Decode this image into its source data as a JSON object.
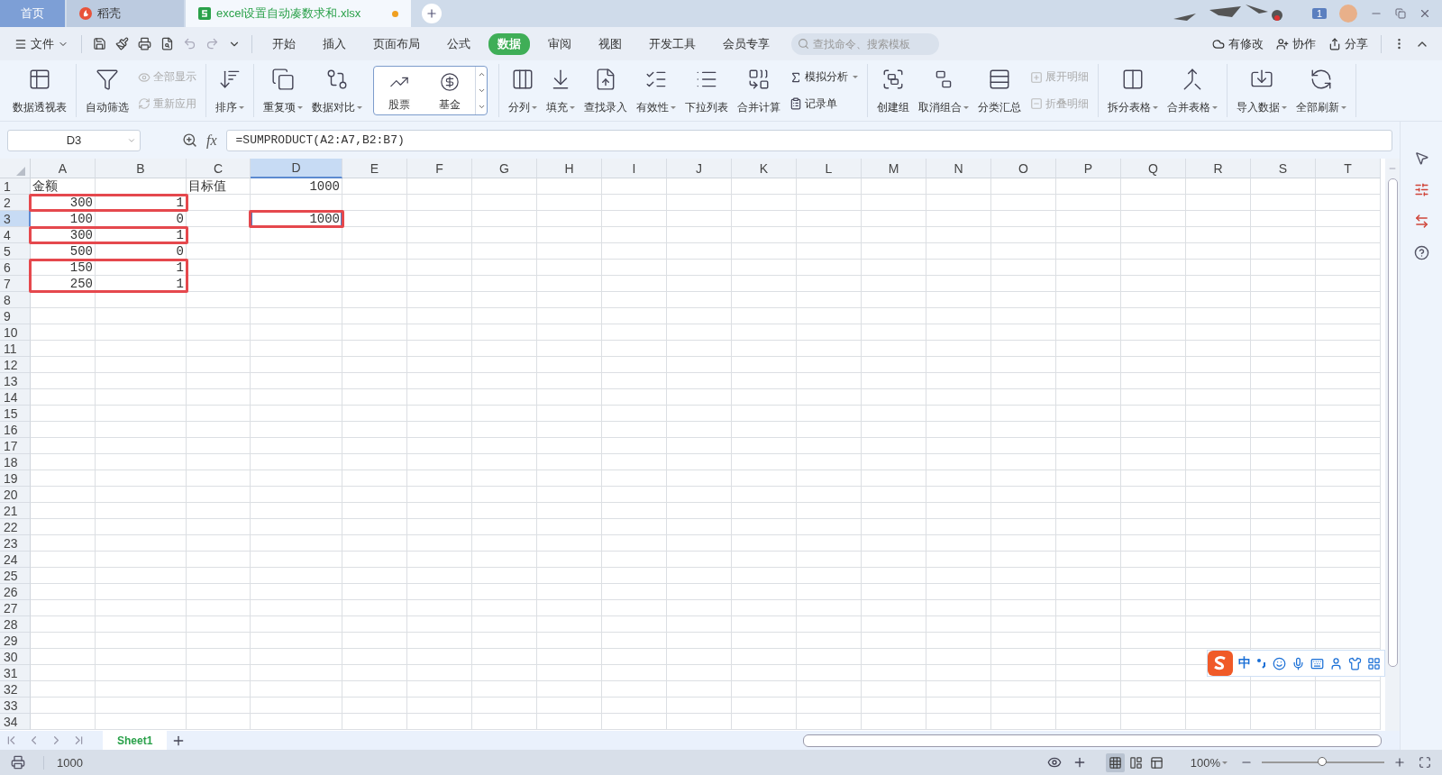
{
  "title_bar": {
    "tabs": [
      {
        "label": "首页",
        "kind": "home",
        "selected": false
      },
      {
        "label": "稻壳",
        "kind": "app",
        "selected": false
      },
      {
        "label": "excel设置自动凑数求和.xlsx",
        "kind": "document",
        "selected": true,
        "modified": true
      }
    ],
    "badge": "1"
  },
  "menu_bar": {
    "file": "文件",
    "tabs": [
      {
        "label": "开始",
        "selected": false
      },
      {
        "label": "插入",
        "selected": false
      },
      {
        "label": "页面布局",
        "selected": false
      },
      {
        "label": "公式",
        "selected": false
      },
      {
        "label": "数据",
        "selected": true
      },
      {
        "label": "审阅",
        "selected": false
      },
      {
        "label": "视图",
        "selected": false
      },
      {
        "label": "开发工具",
        "selected": false
      },
      {
        "label": "会员专享",
        "selected": false
      }
    ],
    "search": {
      "placeholder": "查找命令、搜索模板"
    },
    "actions": [
      "有修改",
      "协作",
      "分享"
    ]
  },
  "ribbon": {
    "groups": [
      {
        "items": [
          {
            "kind": "large",
            "label": "数据透视表",
            "dropdown": false,
            "disabled": false
          }
        ]
      },
      {
        "items": [
          {
            "kind": "large",
            "label": "自动筛选",
            "dropdown": false,
            "disabled": false
          },
          {
            "kind": "small",
            "label": "全部显示",
            "dropdown": false,
            "disabled": true
          },
          {
            "kind": "small",
            "label": "重新应用",
            "dropdown": false,
            "disabled": true
          }
        ]
      },
      {
        "items": [
          {
            "kind": "large",
            "label": "排序",
            "dropdown": true,
            "disabled": false
          }
        ]
      },
      {
        "items": [
          {
            "kind": "large",
            "label": "重复项",
            "dropdown": true,
            "disabled": false
          },
          {
            "kind": "large",
            "label": "数据对比",
            "dropdown": true,
            "disabled": false
          },
          {
            "kind": "gallery",
            "entries": [
              "股票",
              "基金"
            ]
          }
        ]
      },
      {
        "items": [
          {
            "kind": "large",
            "label": "分列",
            "dropdown": true,
            "disabled": false
          },
          {
            "kind": "large",
            "label": "填充",
            "dropdown": true,
            "disabled": false
          },
          {
            "kind": "large",
            "label": "查找录入",
            "dropdown": false,
            "disabled": false
          },
          {
            "kind": "large",
            "label": "有效性",
            "dropdown": true,
            "disabled": false
          },
          {
            "kind": "large",
            "label": "下拉列表",
            "dropdown": false,
            "disabled": false
          },
          {
            "kind": "large",
            "label": "合并计算",
            "dropdown": false,
            "disabled": false
          },
          {
            "kind": "small",
            "label": "模拟分析",
            "dropdown": true,
            "disabled": false
          },
          {
            "kind": "small",
            "label": "记录单",
            "dropdown": false,
            "disabled": false
          }
        ]
      },
      {
        "items": [
          {
            "kind": "large",
            "label": "创建组",
            "dropdown": false,
            "disabled": false
          },
          {
            "kind": "large",
            "label": "取消组合",
            "dropdown": true,
            "disabled": false
          },
          {
            "kind": "large",
            "label": "分类汇总",
            "dropdown": false,
            "disabled": false
          },
          {
            "kind": "small",
            "label": "展开明细",
            "dropdown": false,
            "disabled": true
          },
          {
            "kind": "small",
            "label": "折叠明细",
            "dropdown": false,
            "disabled": true
          }
        ]
      },
      {
        "items": [
          {
            "kind": "large",
            "label": "拆分表格",
            "dropdown": true,
            "disabled": false
          },
          {
            "kind": "large",
            "label": "合并表格",
            "dropdown": true,
            "disabled": false
          }
        ]
      },
      {
        "items": [
          {
            "kind": "large",
            "label": "导入数据",
            "dropdown": true,
            "disabled": false
          },
          {
            "kind": "large",
            "label": "全部刷新",
            "dropdown": true,
            "disabled": false
          }
        ]
      }
    ]
  },
  "formula_bar": {
    "name_box": "D3",
    "fx_label": "fx",
    "formula": "=SUMPRODUCT(A2:A7,B2:B7)"
  },
  "sheet": {
    "columns": [
      "A",
      "B",
      "C",
      "D",
      "E",
      "F",
      "G",
      "H",
      "I",
      "J",
      "K",
      "L",
      "M",
      "N",
      "O",
      "P",
      "Q",
      "R",
      "S",
      "T"
    ],
    "rows": [
      {
        "label": "1",
        "cells": {
          "A": {
            "value": "金额",
            "kind": "text",
            "selected": false,
            "framed": false
          },
          "C": {
            "value": "目标值",
            "kind": "text",
            "selected": false,
            "framed": false
          },
          "D": {
            "value": "1000",
            "kind": "number",
            "selected": false,
            "framed": false
          }
        }
      },
      {
        "label": "2",
        "cells": {
          "A": {
            "value": "300",
            "kind": "number",
            "selected": false,
            "framed": true
          },
          "B": {
            "value": "1",
            "kind": "number",
            "selected": false,
            "framed": true
          }
        }
      },
      {
        "label": "3",
        "cells": {
          "A": {
            "value": "100",
            "kind": "number",
            "selected": false,
            "framed": false
          },
          "B": {
            "value": "0",
            "kind": "number",
            "selected": false,
            "framed": false
          },
          "D": {
            "value": "1000",
            "kind": "number",
            "selected": true,
            "framed": true
          }
        }
      },
      {
        "label": "4",
        "cells": {
          "A": {
            "value": "300",
            "kind": "number",
            "selected": false,
            "framed": true
          },
          "B": {
            "value": "1",
            "kind": "number",
            "selected": false,
            "framed": true
          }
        }
      },
      {
        "label": "5",
        "cells": {
          "A": {
            "value": "500",
            "kind": "number",
            "selected": false,
            "framed": false
          },
          "B": {
            "value": "0",
            "kind": "number",
            "selected": false,
            "framed": false
          }
        }
      },
      {
        "label": "6",
        "cells": {
          "A": {
            "value": "150",
            "kind": "number",
            "selected": false,
            "framed": true
          },
          "B": {
            "value": "1",
            "kind": "number",
            "selected": false,
            "framed": true
          }
        }
      },
      {
        "label": "7",
        "cells": {
          "A": {
            "value": "250",
            "kind": "number",
            "selected": false,
            "framed": true
          },
          "B": {
            "value": "1",
            "kind": "number",
            "selected": false,
            "framed": true
          }
        }
      },
      {
        "label": "8"
      },
      {
        "label": "9"
      },
      {
        "label": "10"
      },
      {
        "label": "11"
      },
      {
        "label": "12"
      },
      {
        "label": "13"
      },
      {
        "label": "14"
      },
      {
        "label": "15"
      },
      {
        "label": "16"
      },
      {
        "label": "17"
      },
      {
        "label": "18"
      },
      {
        "label": "19"
      },
      {
        "label": "20"
      },
      {
        "label": "21"
      },
      {
        "label": "22"
      },
      {
        "label": "23"
      },
      {
        "label": "24"
      },
      {
        "label": "25"
      },
      {
        "label": "26"
      },
      {
        "label": "27"
      },
      {
        "label": "28"
      },
      {
        "label": "29"
      },
      {
        "label": "30"
      },
      {
        "label": "31"
      },
      {
        "label": "32"
      },
      {
        "label": "33"
      },
      {
        "label": "34"
      }
    ]
  },
  "sheet_tabs": [
    {
      "label": "Sheet1",
      "selected": true
    }
  ],
  "ime_toolbar": {
    "mode": "中"
  },
  "status_bar": {
    "value": "1000",
    "zoom": "100%",
    "zoom_slider": {
      "level": 0.49
    },
    "views": [
      {
        "selected": true
      },
      {
        "selected": false
      },
      {
        "selected": false
      }
    ]
  }
}
